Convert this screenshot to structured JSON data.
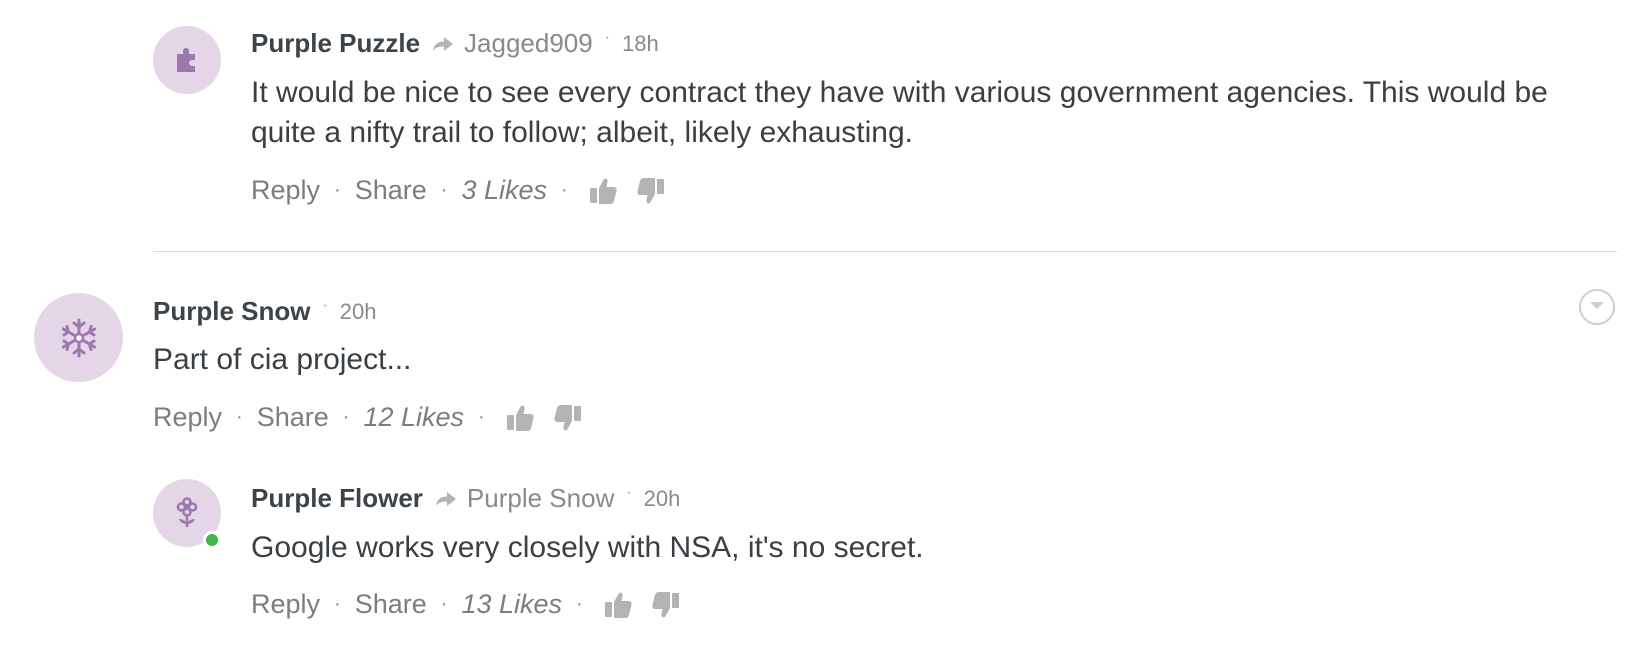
{
  "colors": {
    "avatar_bg": "#e5d6e7",
    "avatar_icon": "#9b79ac",
    "online_dot": "#3fb54a",
    "divider": "#dcdcdc",
    "vote_icon": "#b3b3b3"
  },
  "comments": [
    {
      "author": "Purple Puzzle",
      "reply_to": "Jagged909",
      "time": "18h",
      "avatar_icon": "puzzle-icon",
      "text": "It would be nice to see every contract they have with various government agencies. This would be quite a nifty trail to follow; albeit, likely exhausting.",
      "reply_label": "Reply",
      "share_label": "Share",
      "likes": "3 Likes"
    },
    {
      "author": "Purple Snow",
      "time": "20h",
      "avatar_icon": "snowflake-icon",
      "text": "Part of cia project...",
      "reply_label": "Reply",
      "share_label": "Share",
      "likes": "12 Likes"
    },
    {
      "author": "Purple Flower",
      "reply_to": "Purple Snow",
      "time": "20h",
      "avatar_icon": "flower-icon",
      "online": true,
      "text": "Google works very closely with NSA, it's no secret.",
      "reply_label": "Reply",
      "share_label": "Share",
      "likes": "13 Likes"
    }
  ],
  "separators": {
    "meta_dot": "·",
    "action_dot": "·"
  }
}
